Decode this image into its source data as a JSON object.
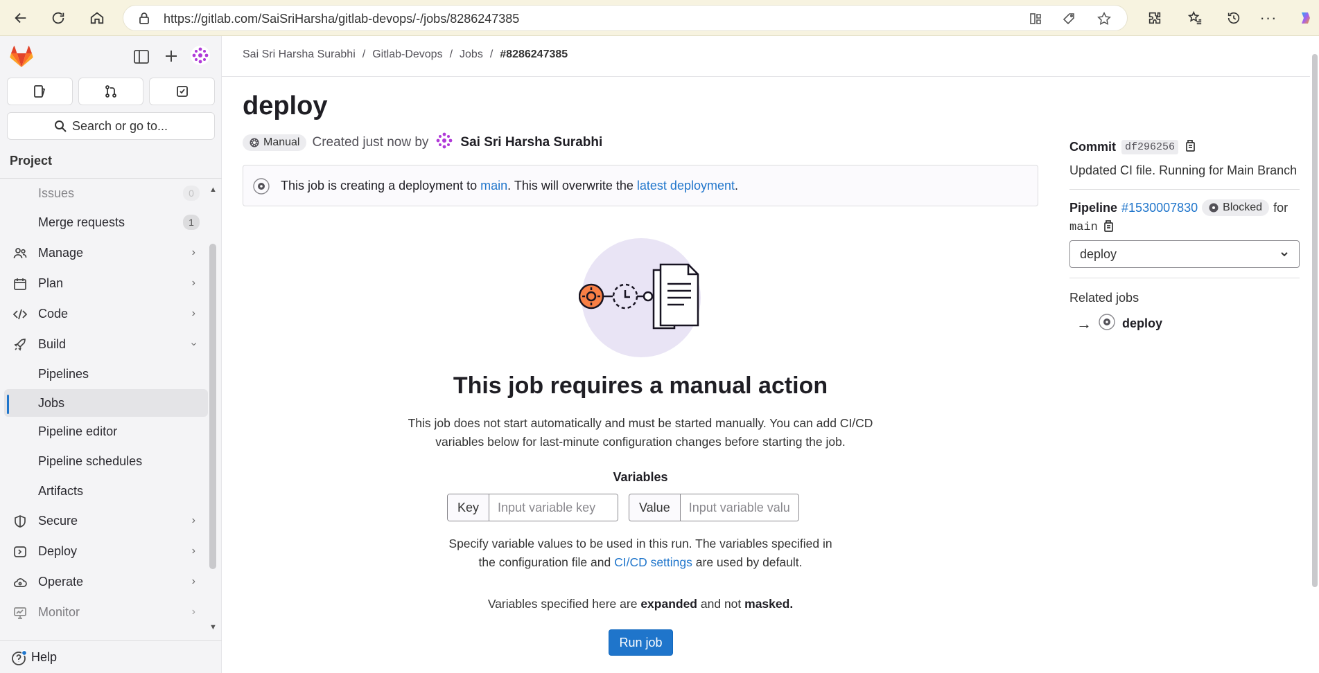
{
  "browser": {
    "url": "https://gitlab.com/SaiSriHarsha/gitlab-devops/-/jobs/8286247385"
  },
  "sidebar": {
    "search_label": "Search or go to...",
    "section": "Project",
    "items": [
      {
        "label": "Issues",
        "count": "0",
        "icon": "issues-icon"
      },
      {
        "label": "Merge requests",
        "count": "1",
        "icon": "merge-icon"
      },
      {
        "label": "Manage",
        "icon": "users-icon"
      },
      {
        "label": "Plan",
        "icon": "calendar-icon"
      },
      {
        "label": "Code",
        "icon": "code-icon"
      },
      {
        "label": "Build",
        "icon": "rocket-icon"
      },
      {
        "label": "Pipelines"
      },
      {
        "label": "Jobs"
      },
      {
        "label": "Pipeline editor"
      },
      {
        "label": "Pipeline schedules"
      },
      {
        "label": "Artifacts"
      },
      {
        "label": "Secure",
        "icon": "shield-icon"
      },
      {
        "label": "Deploy",
        "icon": "deploy-icon"
      },
      {
        "label": "Operate",
        "icon": "cloud-icon"
      },
      {
        "label": "Monitor",
        "icon": "monitor-icon"
      }
    ],
    "help": "Help"
  },
  "breadcrumb": [
    "Sai Sri Harsha Surabhi",
    "Gitlab-Devops",
    "Jobs",
    "#8286247385"
  ],
  "job": {
    "title": "deploy",
    "status_badge": "Manual",
    "created_text": "Created just now by",
    "author": "Sai Sri Harsha Surabhi"
  },
  "alert": {
    "part1": "This job is creating a deployment to ",
    "env_link": "main",
    "part2": ". This will overwrite the ",
    "latest_link": "latest deployment",
    "part3": "."
  },
  "empty_state": {
    "heading": "This job requires a manual action",
    "description": "This job does not start automatically and must be started manually. You can add CI/CD variables below for last-minute configuration changes before starting the job.",
    "variables_title": "Variables",
    "key_label": "Key",
    "key_placeholder": "Input variable key",
    "value_label": "Value",
    "value_placeholder": "Input variable value",
    "note_part1": "Specify variable values to be used in this run. The variables specified in the configuration file and ",
    "note_link": "CI/CD settings",
    "note_part2": " are used by default.",
    "note2_part1": "Variables specified here are ",
    "note2_b1": "expanded",
    "note2_part2": " and not ",
    "note2_b2": "masked.",
    "run_button": "Run job"
  },
  "right_panel": {
    "commit_label": "Commit",
    "commit_sha": "df296256",
    "commit_message": "Updated CI file. Running for Main Branch",
    "pipeline_label": "Pipeline",
    "pipeline_id": "#1530007830",
    "pipeline_status": "Blocked",
    "for_text": "for",
    "branch": "main",
    "stage_select": "deploy",
    "related_jobs_label": "Related jobs",
    "related_job": "deploy"
  },
  "colors": {
    "accent": "#1f75cb",
    "brand": "#e24329"
  }
}
